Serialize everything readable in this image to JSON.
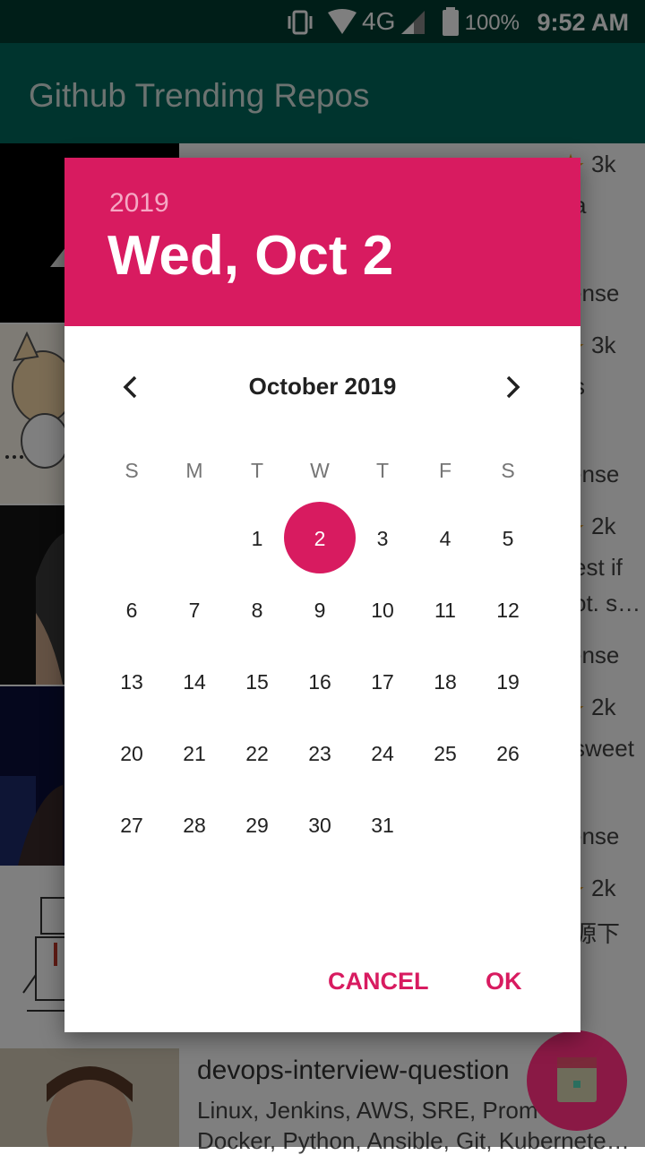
{
  "status_bar": {
    "network": "4G",
    "battery": "100%",
    "time": "9:52 AM"
  },
  "app_bar": {
    "title": "Github Trending Repos"
  },
  "list": {
    "rows": [
      {
        "stars": "3k",
        "desc1": "a",
        "desc2": "",
        "license": "cense"
      },
      {
        "stars": "3k",
        "desc1": "s",
        "desc2": "",
        "license": "cense"
      },
      {
        "stars": "2k",
        "desc1": "est if",
        "desc2": "ot. s…",
        "license": "cense"
      },
      {
        "stars": "2k",
        "desc1": "sweet",
        "desc2": "",
        "license": "cense"
      },
      {
        "stars": "2k",
        "desc1": "源下",
        "desc2": "",
        "license": ""
      }
    ],
    "last_row": {
      "name": "devops-interview-question",
      "desc1": "Linux, Jenkins, AWS, SRE, Prom",
      "desc2": "Docker, Python, Ansible, Git, Kubernete…"
    }
  },
  "date_picker": {
    "year": "2019",
    "selected_date_label": "Wed, Oct 2",
    "month_label": "October 2019",
    "weekdays": [
      "S",
      "M",
      "T",
      "W",
      "T",
      "F",
      "S"
    ],
    "days": [
      "1",
      "2",
      "3",
      "4",
      "5",
      "6",
      "7",
      "8",
      "9",
      "10",
      "11",
      "12",
      "13",
      "14",
      "15",
      "16",
      "17",
      "18",
      "19",
      "20",
      "21",
      "22",
      "23",
      "24",
      "25",
      "26",
      "27",
      "28",
      "29",
      "30",
      "31"
    ],
    "selected_day": "2",
    "cancel_label": "CANCEL",
    "ok_label": "OK"
  },
  "colors": {
    "accent": "#d81b60",
    "app_bar": "#00695c",
    "status_bar": "#003d31"
  },
  "icons": [
    "vibrate-icon",
    "wifi-icon",
    "signal-icon",
    "battery-icon",
    "star-icon",
    "chevron-left-icon",
    "chevron-right-icon",
    "calendar-icon"
  ]
}
